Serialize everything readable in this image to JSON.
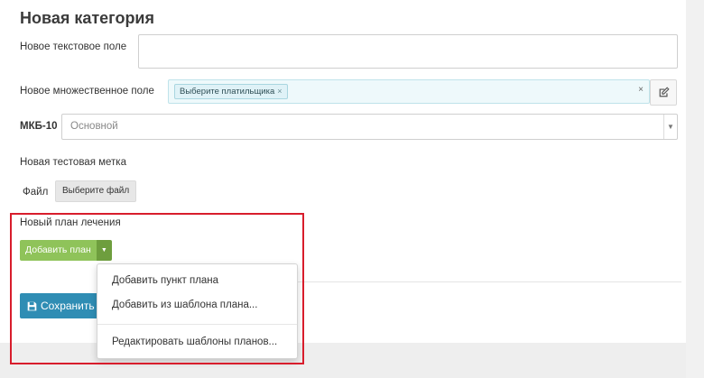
{
  "form": {
    "title": "Новая категория",
    "text_field": {
      "label": "Новое текстовое поле",
      "value": ""
    },
    "multi_field": {
      "label": "Новое множественное поле",
      "tag": "Выберите платильщика",
      "tag_remove": "×",
      "clear": "×"
    },
    "icd": {
      "label": "МКБ-10",
      "selected": "Основной",
      "arrow": "▼"
    },
    "test_label": "Новая тестовая метка",
    "file": {
      "label": "Файл",
      "button": "Выберите файл"
    },
    "treatment_plan": {
      "label": "Новый план лечения",
      "add_button": "Добавить план",
      "toggle": "▼"
    },
    "save_button": "Сохранить"
  },
  "dropdown": {
    "items": [
      "Добавить пункт плана",
      "Добавить из шаблона плана...",
      "Редактировать шаблоны планов..."
    ]
  },
  "icons": [
    "edit-icon",
    "save-icon",
    "caret-down-icon",
    "close-icon"
  ],
  "colors": {
    "primary": "#2f8db4",
    "success": "#8fc35a",
    "success_dark": "#6e9e3e",
    "highlight": "#d81d2c",
    "tag_bg": "#dff2f7"
  }
}
